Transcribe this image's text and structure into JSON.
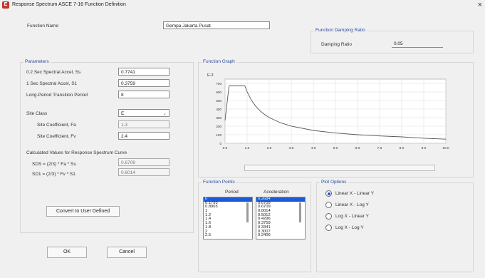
{
  "window": {
    "title": "Response Spectrum ASCE 7-16 Function Definition",
    "icon_letter": "E",
    "close_glyph": "×"
  },
  "function_name": {
    "label": "Function Name",
    "value": "Gempa Jakarta Pusat"
  },
  "damping": {
    "group_title": "Function Damping Ratio",
    "label": "Damping Ratio",
    "value": "0.05"
  },
  "parameters": {
    "group_title": "Parameters",
    "ss": {
      "label": "0.2 Sec Spectral Accel, Ss",
      "value": "0.7741"
    },
    "s1": {
      "label": "1 Sec Spectral Accel, S1",
      "value": "0.3759"
    },
    "tl": {
      "label": "Long-Period Transition Period",
      "value": "8"
    },
    "site_class": {
      "label": "Site Class",
      "value": "E"
    },
    "fa": {
      "label": "Site Coefficient, Fa",
      "value": "1.3"
    },
    "fv": {
      "label": "Site Coefficient, Fv",
      "value": "2.4"
    },
    "calc_title": "Calculated Values for Response Spectrum Curve",
    "sds": {
      "label": "SDS = (2/3) * Fa * Ss",
      "value": "0.6709"
    },
    "sd1": {
      "label": "SD1 = (2/3) * Fv * S1",
      "value": "0.6014"
    }
  },
  "graph": {
    "group_title": "Function Graph",
    "y_unit": "E-3",
    "y_ticks": [
      "700",
      "600",
      "500",
      "400",
      "300",
      "200",
      "100",
      "0"
    ],
    "x_ticks": [
      "0.0",
      "1.0",
      "2.0",
      "3.0",
      "4.0",
      "5.0",
      "6.0",
      "7.0",
      "8.0",
      "9.0",
      "10.0"
    ]
  },
  "chart_data": {
    "type": "line",
    "x": [
      0,
      0.1793,
      0.8965,
      1.0,
      1.2,
      1.4,
      1.6,
      1.8,
      2.0,
      2.5,
      3.0,
      4.0,
      5.0,
      6.0,
      7.0,
      8.0,
      9.0,
      10.0
    ],
    "y": [
      268.4,
      670.9,
      670.9,
      601.4,
      501.2,
      429.6,
      375.9,
      334.1,
      300.7,
      240.6,
      200.5,
      150.4,
      120.3,
      100.2,
      85.9,
      75.2,
      59.4,
      48.1
    ],
    "xlabel": "",
    "ylabel": "",
    "xlim": [
      0,
      10
    ],
    "ylim": [
      0,
      750
    ],
    "grid": true
  },
  "points": {
    "group_title": "Function Points",
    "period_header": "Period",
    "accel_header": "Acceleration",
    "periods": [
      "0",
      "0.1793",
      "0.8965",
      "1",
      "1.2",
      "1.4",
      "1.6",
      "1.8",
      "2",
      "2.5"
    ],
    "accels": [
      "0.2684",
      "0.6709",
      "0.6709",
      "0.6014",
      "0.5012",
      "0.4296",
      "0.3759",
      "0.3341",
      "0.3007",
      "0.2406"
    ]
  },
  "plot_options": {
    "group_title": "Plot Options",
    "options": [
      "Linear X - Linear Y",
      "Linear X - Log Y",
      "Log X - Linear Y",
      "Log X - Log Y"
    ],
    "selected": 0
  },
  "buttons": {
    "convert": "Convert to User Defined",
    "ok": "OK",
    "cancel": "Cancel"
  },
  "colors": {
    "accent": "#1b5bd6",
    "group_title": "#2a4a9a",
    "curve": "#555555"
  }
}
